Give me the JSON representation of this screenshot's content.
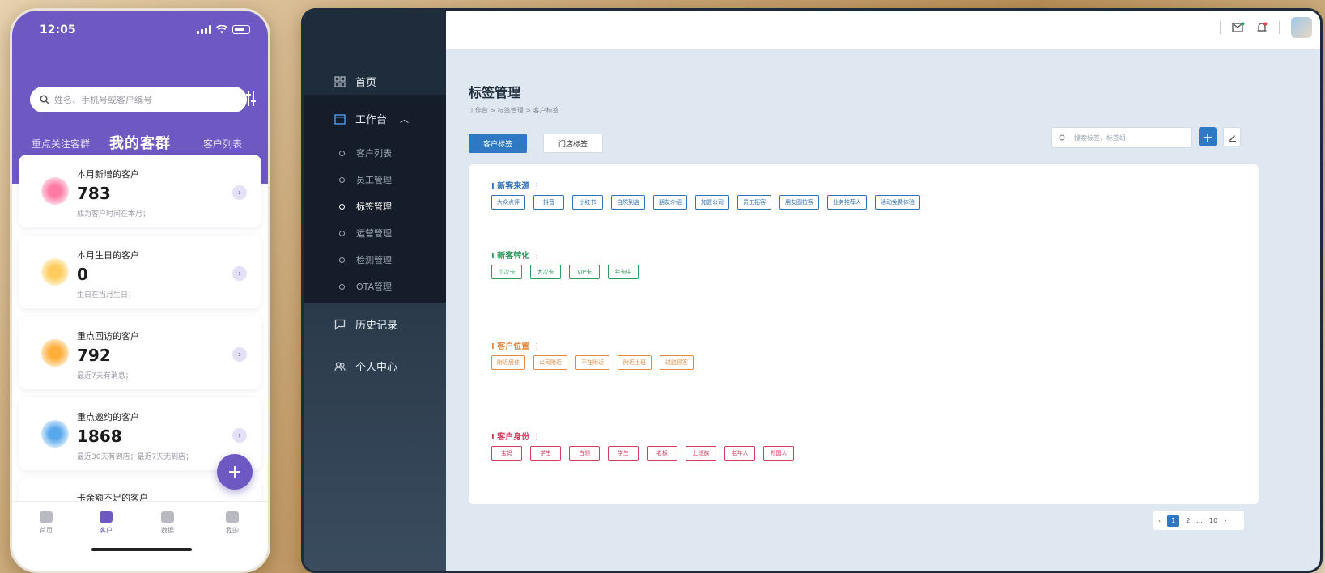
{
  "phone": {
    "status_time": "12:05",
    "battery_level": "6",
    "search_placeholder": "姓名、手机号或客户编号",
    "tabs": [
      "重点关注客群",
      "我的客群",
      "客户列表"
    ],
    "active_tab_index": 1,
    "cards": [
      {
        "title": "本月新增的客户",
        "value": "783",
        "desc": "成为客户时间在本月；",
        "icon": "heart-icon"
      },
      {
        "title": "本月生日的客户",
        "value": "0",
        "desc": "生日在当月生日；",
        "icon": "cake-icon"
      },
      {
        "title": "重点回访的客户",
        "value": "792",
        "desc": "最近7天有消息；",
        "icon": "chat-icon"
      },
      {
        "title": "重点邀约的客户",
        "value": "1868",
        "desc": "最近30天有到店；最近7天无到店；",
        "icon": "clock-icon"
      },
      {
        "title": "卡余额不足的客户",
        "value": "",
        "desc": "",
        "icon": "card-icon"
      }
    ],
    "fab_label": "+",
    "bottom_nav": [
      "首页",
      "客户",
      "数据",
      "我的"
    ],
    "active_nav_index": 1
  },
  "desktop": {
    "sidebar": {
      "home": "首页",
      "workbench": "工作台",
      "sub_items": [
        "客户列表",
        "员工管理",
        "标签管理",
        "运营管理",
        "检测管理",
        "OTA管理"
      ],
      "active_sub_index": 2,
      "history": "历史记录",
      "profile": "个人中心"
    },
    "page_title": "标签管理",
    "breadcrumb": "工作台 > 标签管理 > 客户标签",
    "tab_buttons": [
      "客户标签",
      "门店标签"
    ],
    "search_placeholder": "搜索标签、标签组",
    "groups": [
      {
        "title": "I 新客来源",
        "color": "blue",
        "tags": [
          "大众点评",
          "抖音",
          "小红书",
          "自然到店",
          "朋友介绍",
          "加盟公司",
          "员工拓客",
          "朋友圈拉客",
          "业务推荐人",
          "活动免费体验"
        ]
      },
      {
        "title": "I 新客转化",
        "color": "green",
        "tags": [
          "小次卡",
          "大次卡",
          "VIP卡",
          "年卡中"
        ]
      },
      {
        "title": "I 客户位置",
        "color": "orange",
        "tags": [
          "附近居住",
          "公司附近",
          "不在附近",
          "附近上班",
          "过路顾客"
        ]
      },
      {
        "title": "I 客户身份",
        "color": "red",
        "tags": [
          "宝妈",
          "学生",
          "白领",
          "学生",
          "老板",
          "上班族",
          "老年人",
          "外国人"
        ]
      }
    ],
    "pagination": {
      "current": "1",
      "next": "2",
      "ellipsis": "...",
      "last": "10"
    }
  }
}
